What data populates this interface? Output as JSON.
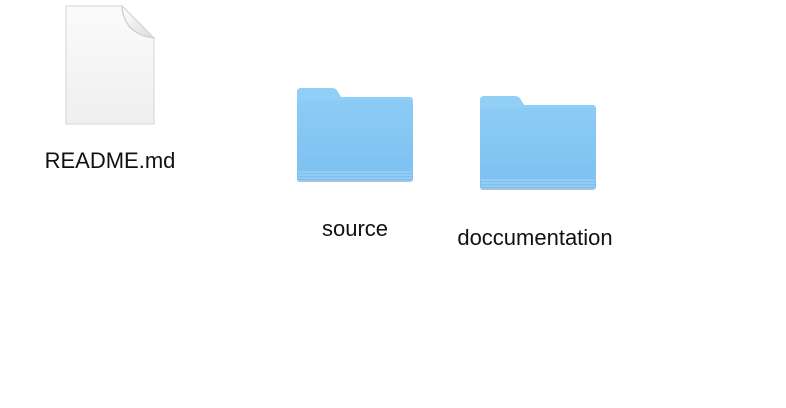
{
  "desktop": {
    "items": [
      {
        "label": "README.md",
        "icon": "document-icon"
      },
      {
        "label": "source",
        "icon": "folder-icon"
      },
      {
        "label": "doccumentation",
        "icon": "folder-icon"
      }
    ]
  },
  "colors": {
    "background": "#ffffff",
    "folder_body": "#84c6f3",
    "folder_tab": "#8fcdf5",
    "document_page": "#f6f6f6",
    "label_text": "#111111"
  }
}
